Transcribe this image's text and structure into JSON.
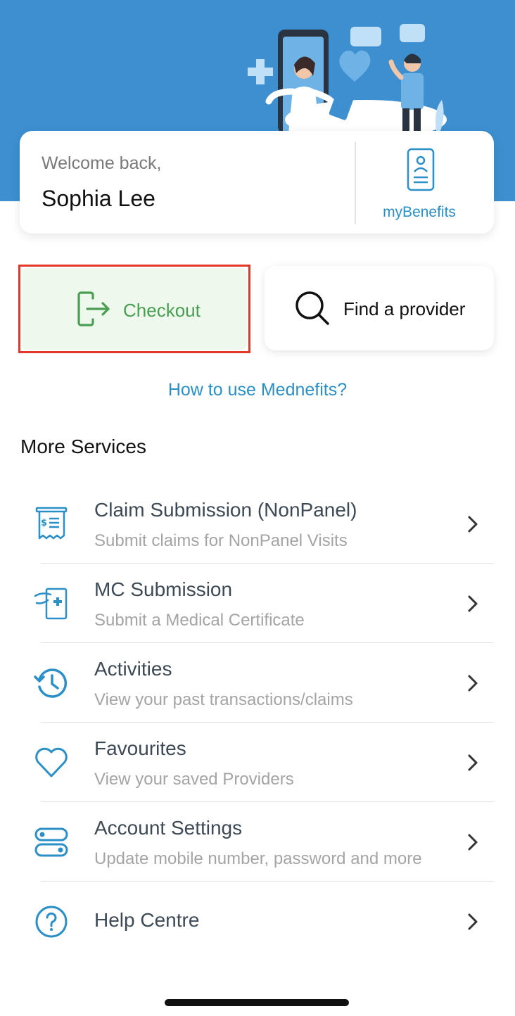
{
  "welcome": {
    "greeting": "Welcome back,",
    "user_name": "Sophia Lee",
    "benefits_label": "myBenefits"
  },
  "actions": {
    "checkout_label": "Checkout",
    "find_provider_label": "Find a provider"
  },
  "help_link": "How to use Mednefits?",
  "section_title": "More Services",
  "services": [
    {
      "title": "Claim Submission (NonPanel)",
      "subtitle": "Submit claims for NonPanel Visits",
      "icon": "receipt-icon"
    },
    {
      "title": "MC Submission",
      "subtitle": "Submit a Medical Certificate",
      "icon": "medical-certificate-icon"
    },
    {
      "title": "Activities",
      "subtitle": "View your past transactions/claims",
      "icon": "history-icon"
    },
    {
      "title": "Favourites",
      "subtitle": "View your saved Providers",
      "icon": "heart-icon"
    },
    {
      "title": "Account Settings",
      "subtitle": "Update mobile number, password and more",
      "icon": "settings-toggle-icon"
    },
    {
      "title": "Help Centre",
      "icon": "question-circle-icon"
    }
  ],
  "colors": {
    "brand_blue": "#3d8fd0",
    "link_blue": "#2b8fc8",
    "checkout_green": "#4a9e53",
    "checkout_bg": "#eef8ec",
    "highlight_red": "#e2382a"
  }
}
